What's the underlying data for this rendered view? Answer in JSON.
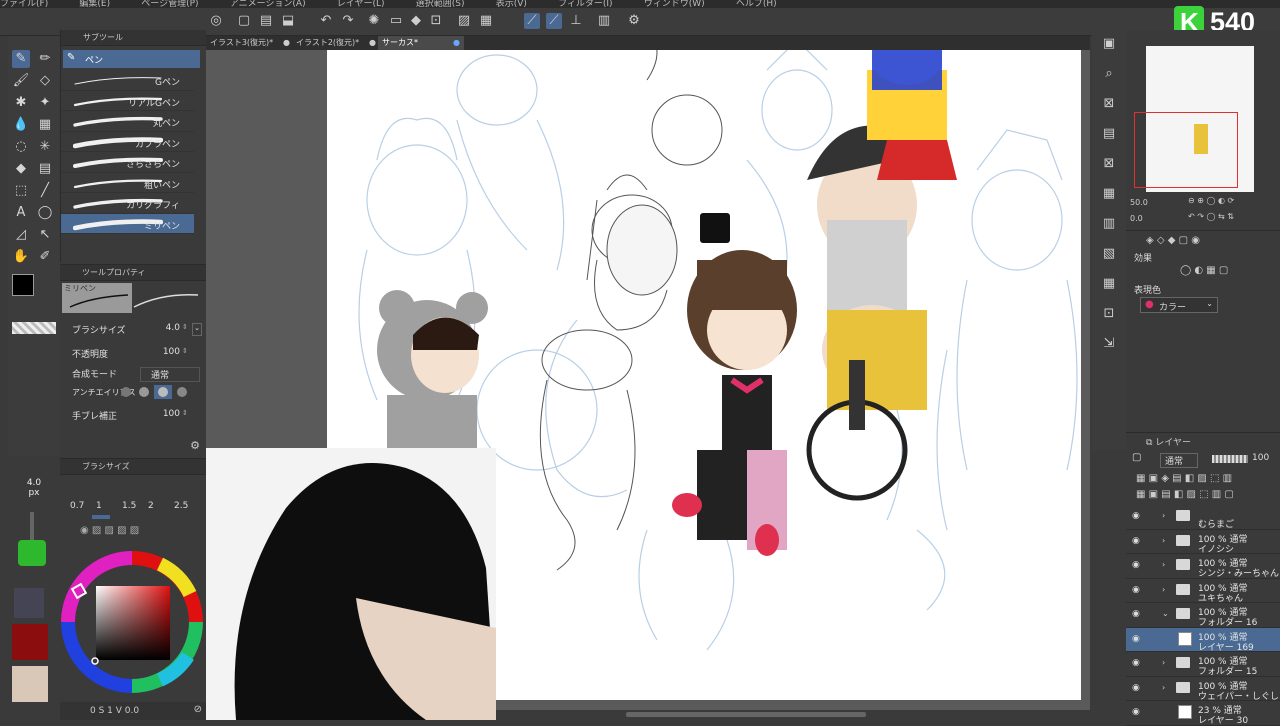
{
  "menubar": {
    "items": [
      "ファイル(F)",
      "編集(E)",
      "ページ管理(P)",
      "アニメーション(A)",
      "レイヤー(L)",
      "選択範囲(S)",
      "表示(V)",
      "フィルター(I)",
      "ウィンドウ(W)",
      "ヘルプ(H)"
    ]
  },
  "logo": {
    "letter": "K",
    "number": "540",
    "accent": "#3cd23c"
  },
  "subtool": {
    "header": "サブツール",
    "category": "ペン",
    "brushes": [
      "Gペン",
      "リアルGペン",
      "丸ペン",
      "カブラペン",
      "さらさらペン",
      "粗いペン",
      "カリグラフィ",
      "ミリペン"
    ]
  },
  "toolprop": {
    "header": "ツールプロパティ",
    "preview_label": "ミリペン",
    "brush_size_label": "ブラシサイズ",
    "brush_size_value": "4.0",
    "opacity_label": "不透明度",
    "opacity_value": "100",
    "blend_label": "合成モード",
    "blend_value": "通常",
    "antialias_label": "アンチエイリアス",
    "stabilize_label": "手ブレ補正",
    "stabilize_value": "100"
  },
  "brushsize": {
    "header": "ブラシサイズ",
    "current": "4.0",
    "unit": "px",
    "options": [
      "0.7",
      "1",
      "1.5",
      "2",
      "2.5"
    ]
  },
  "tabs": [
    {
      "label": "イラスト3(復元)*"
    },
    {
      "label": "イラスト2(復元)*"
    },
    {
      "label": "サーカス*"
    }
  ],
  "navigator": {
    "zoom": "50.0",
    "rotate": "0.0"
  },
  "effect": {
    "header": "効果",
    "color_label": "表現色",
    "color_value": "カラー"
  },
  "layers": {
    "blend": "通常",
    "opacity": "100",
    "rows": [
      {
        "line1": "",
        "line2": "むらまご",
        "type": "folder",
        "selected": false
      },
      {
        "line1": "100 % 通常",
        "line2": "イノシシ",
        "type": "folder",
        "selected": false
      },
      {
        "line1": "100 % 通常",
        "line2": "シンジ・みーちゃん",
        "type": "folder",
        "selected": false
      },
      {
        "line1": "100 % 通常",
        "line2": "ユキちゃん",
        "type": "folder",
        "selected": false
      },
      {
        "line1": "100 % 通常",
        "line2": "フォルダー 16",
        "type": "folder-open",
        "selected": false
      },
      {
        "line1": "100 % 通常",
        "line2": "レイヤー 169",
        "type": "layer",
        "selected": true
      },
      {
        "line1": "100 % 通常",
        "line2": "フォルダー 15",
        "type": "folder",
        "selected": false
      },
      {
        "line1": "100 % 通常",
        "line2": "ウェイパー・しぐしぐ",
        "type": "folder",
        "selected": false
      },
      {
        "line1": "23 % 通常",
        "line2": "レイヤー 30",
        "type": "layer",
        "selected": false
      }
    ]
  },
  "status": {
    "left": "0 S 1 V 0.0"
  },
  "colors": {
    "ui_dark": "#3a3a3a",
    "selection": "#4a6a94",
    "canvas_bg": "#5a5a5a",
    "main_color": "#000000"
  }
}
